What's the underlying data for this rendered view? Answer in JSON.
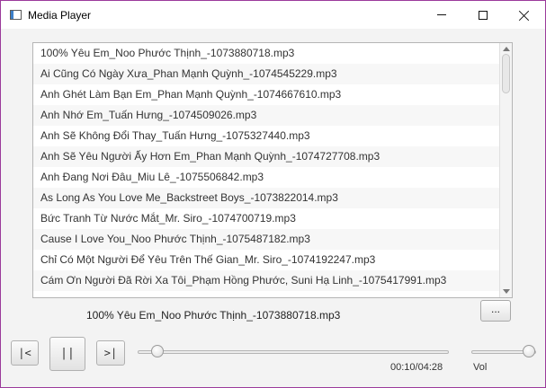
{
  "window": {
    "title": "Media Player",
    "accent_border": "#9b3a9b"
  },
  "titlebar": {
    "minimize_icon": "minimize-icon",
    "maximize_icon": "maximize-icon",
    "close_icon": "close-icon"
  },
  "playlist": {
    "items": [
      "100% Yêu Em_Noo Phước Thịnh_-1073880718.mp3",
      "Ai Cũng Có Ngày Xưa_Phan Mạnh Quỳnh_-1074545229.mp3",
      "Anh Ghét Làm Bạn Em_Phan Mạnh Quỳnh_-1074667610.mp3",
      "Anh Nhớ Em_Tuấn Hưng_-1074509026.mp3",
      "Anh Sẽ Không Đổi Thay_Tuấn Hưng_-1075327440.mp3",
      "Anh Sẽ Yêu Người Ấy Hơn Em_Phan Mạnh Quỳnh_-1074727708.mp3",
      "Anh Đang Nơi Đâu_Miu Lê_-1075506842.mp3",
      "As Long As You Love Me_Backstreet Boys_-1073822014.mp3",
      "Bức Tranh Từ Nước Mắt_Mr. Siro_-1074700719.mp3",
      "Cause I Love You_Noo Phước Thịnh_-1075487182.mp3",
      "Chỉ Có Một Người Để Yêu Trên Thế Gian_Mr. Siro_-1074192247.mp3",
      "Cám Ơn Người Đã Rời Xa Tôi_Phạm Hồng Phước, Suni Hạ Linh_-1075417991.mp3"
    ]
  },
  "now_playing": {
    "track": "100% Yêu Em_Noo Phước Thịnh_-1073880718.mp3",
    "browse_label": "..."
  },
  "controls": {
    "prev_label": "|<",
    "pause_label": "||",
    "next_label": ">|",
    "time": "00:10/04:28",
    "seek_fraction": 0.04,
    "volume_label": "Vol",
    "volume_fraction": 1.0
  }
}
